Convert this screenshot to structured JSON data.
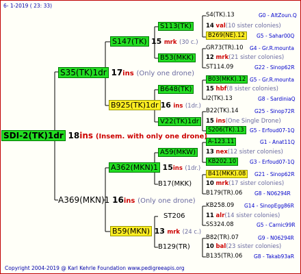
{
  "header": "6-  1-2019 ( 23: 33)",
  "footer": "Copyright 2004-2019 @ Karl Kehrle Foundation    www.pedigreeapis.org",
  "root": {
    "name": "SDI-2(TK)1dr",
    "count": "18",
    "unit": "ins",
    "note": "(Insem. with only one drone)"
  },
  "gen1": [
    {
      "name": "S35(TK)1dr",
      "count": "17",
      "unit": "ins",
      "note": "(Only one drone)"
    },
    {
      "name": "A369(MKN)1",
      "count": "16",
      "unit": "ins",
      "note": "(Only one drone)"
    }
  ],
  "gen2": [
    {
      "name": "S147(TK)",
      "count": "15",
      "unit": "mrk",
      "note": "(30 c.)"
    },
    {
      "name": "B925(TK)1dr",
      "count": "16",
      "unit": "ins",
      "note": "(1dr.)"
    },
    {
      "name": "A362(MKN)1",
      "count": "15",
      "unit": "ins",
      "note": "(1dr.)"
    },
    {
      "name": "B59(MKN)",
      "count": "13",
      "unit": "mrk",
      "note": "(24 c.)"
    }
  ],
  "gen3": [
    {
      "name": "S113(TK)",
      "count": "14",
      "unit": "val",
      "note": "(10 sister colonies)"
    },
    {
      "name": "B53(MKK)",
      "count": "12",
      "unit": "mrk",
      "note": "(21 sister colonies)"
    },
    {
      "name": "B648(TK)",
      "count": "15",
      "unit": "hbf",
      "note": "(8 sister colonies)"
    },
    {
      "name": "V22(TK)1dr",
      "count": "15",
      "unit": "ins",
      "note": "(One Single Drone)"
    },
    {
      "name": "A59(MKW)",
      "count": "13",
      "unit": "nex",
      "note": "(12 sister colonies)"
    },
    {
      "name": "B17(MKK)",
      "count": "10",
      "unit": "mrk",
      "note": "(17 sister colonies)"
    },
    {
      "name": "ST206",
      "count": "11",
      "unit": "alr",
      "note": "(14 sister colonies)"
    },
    {
      "name": "B129(TR)",
      "count": "10",
      "unit": "bal",
      "note": "(23 sister colonies)"
    }
  ],
  "gen4": [
    {
      "name": "S4(TK).13",
      "right": "G0 - AltZoun.Q"
    },
    {
      "name": "B269(NE).12",
      "right": "G5 - Sahar00Q"
    },
    {
      "name": "GR73(TR).10",
      "right": "G4 - Gr.R.mounta"
    },
    {
      "name": "ST114.09",
      "right": "G22 - Sinop62R"
    },
    {
      "name": "B03(MKK).12",
      "right": "G5 - Gr.R.mounta"
    },
    {
      "name": "I2(TK).13",
      "right": "G8 - SardiniaQ"
    },
    {
      "name": "B22(TK).14",
      "right": "G25 - Sinop72R"
    },
    {
      "name": "S206(TK).13",
      "right": "G5 - Erfoud07-1Q"
    },
    {
      "name": "A-123.11",
      "right": "G1 - Anat11Q"
    },
    {
      "name": "KB202.10",
      "right": "G3 - Erfoud07-1Q"
    },
    {
      "name": "B41(MKK).08",
      "right": "G21 - Sinop62R"
    },
    {
      "name": "B179(TR).06",
      "right": "G8 - N06294R"
    },
    {
      "name": "KB258.09",
      "right": "G14 - SinopEgg86R"
    },
    {
      "name": "SS324.08",
      "right": "G5 - Carnic99R"
    },
    {
      "name": "B82(TR).07",
      "right": "G9 - N06294R"
    },
    {
      "name": "B135(TR).06",
      "right": "G8 - Takab93aR"
    }
  ],
  "colors": {
    "green_box": "#22dd22",
    "yellow_box": "#ffee22",
    "ins_red": "#cc0000",
    "blue_text": "#0000cc",
    "border": "#c00000"
  }
}
